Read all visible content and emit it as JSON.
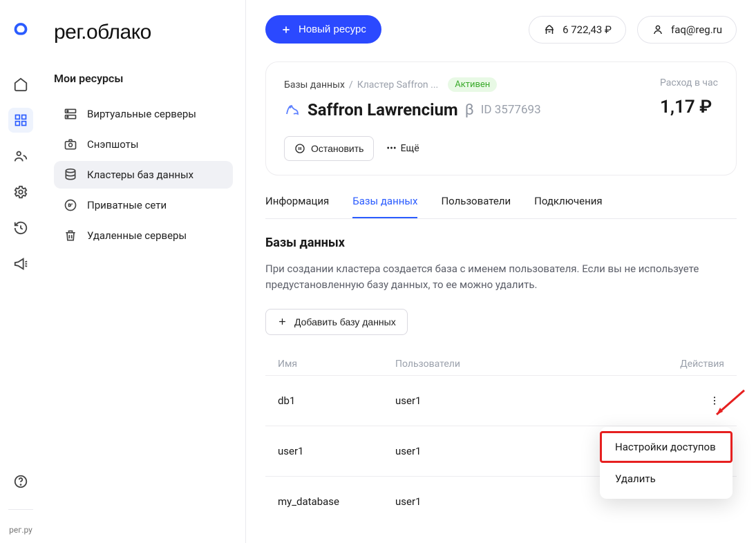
{
  "brand": "рег.облако",
  "footer_brand": "рег.ру",
  "topbar": {
    "new_resource": "Новый ресурс",
    "balance": "6 722,43 ₽",
    "account": "faq@reg.ru"
  },
  "sidebar": {
    "section": "Мои ресурсы",
    "items": [
      {
        "label": "Виртуальные серверы"
      },
      {
        "label": "Снэпшоты"
      },
      {
        "label": "Кластеры баз данных"
      },
      {
        "label": "Приватные сети"
      },
      {
        "label": "Удаленные серверы"
      }
    ]
  },
  "card": {
    "crumb_root": "Базы данных",
    "crumb_item": "Кластер Saffron ...",
    "status": "Активен",
    "title": "Saffron Lawrencium",
    "beta": "β",
    "id_label": "ID 3577693",
    "rate_label": "Расход в час",
    "rate_value": "1,17 ₽",
    "stop_btn": "Остановить",
    "more_btn": "Ещё"
  },
  "tabs": [
    {
      "label": "Информация",
      "active": false
    },
    {
      "label": "Базы данных",
      "active": true
    },
    {
      "label": "Пользователи",
      "active": false
    },
    {
      "label": "Подключения",
      "active": false
    }
  ],
  "content": {
    "heading": "Базы данных",
    "hint": "При создании кластера создается база с именем пользователя. Если вы не используете предустановленную базу данных, то ее можно удалить.",
    "add_btn": "Добавить базу данных",
    "columns": {
      "name": "Имя",
      "users": "Пользователи",
      "actions": "Действия"
    },
    "rows": [
      {
        "name": "db1",
        "users": "user1"
      },
      {
        "name": "user1",
        "users": "user1"
      },
      {
        "name": "my_database",
        "users": "user1"
      }
    ]
  },
  "popover": {
    "settings": "Настройки доступов",
    "delete": "Удалить"
  }
}
